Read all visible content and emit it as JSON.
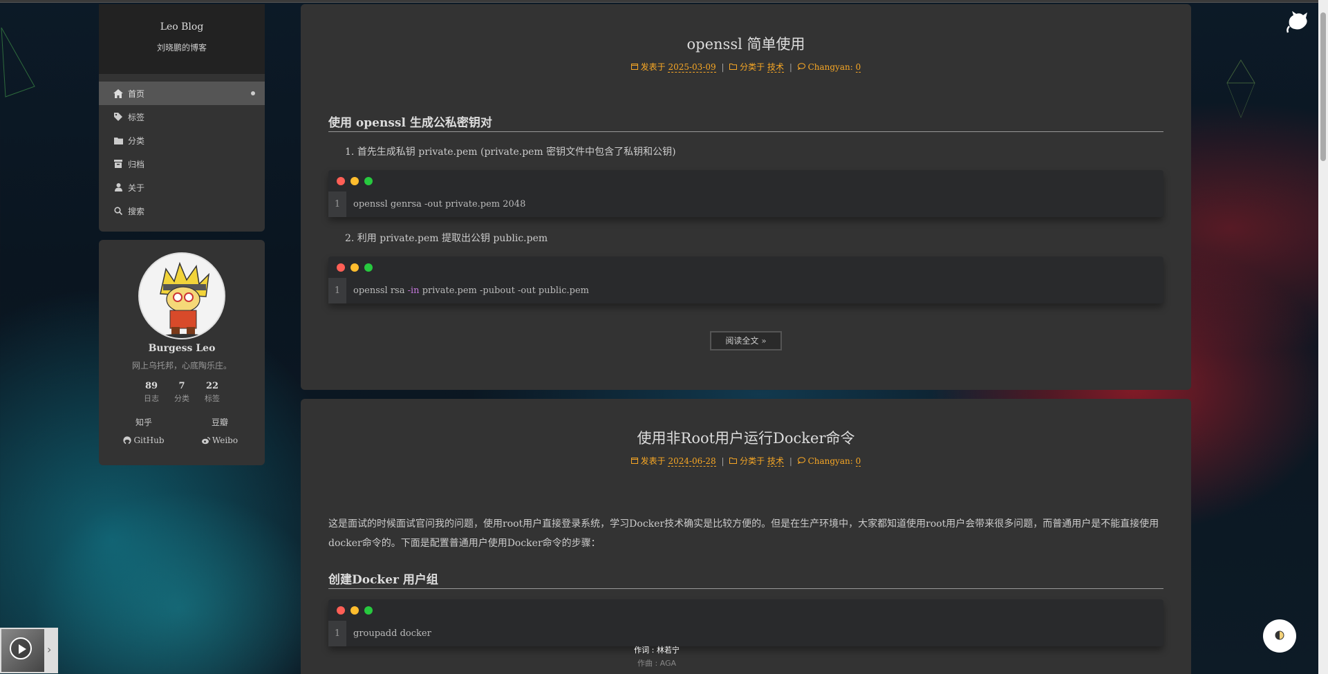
{
  "site": {
    "title": "Leo Blog",
    "subtitle": "刘晓鹏的博客"
  },
  "menu": {
    "items": [
      {
        "label": "首页",
        "icon": "home-icon"
      },
      {
        "label": "标签",
        "icon": "tag-icon"
      },
      {
        "label": "分类",
        "icon": "folder-icon"
      },
      {
        "label": "归档",
        "icon": "archive-icon"
      },
      {
        "label": "关于",
        "icon": "user-icon"
      },
      {
        "label": "搜索",
        "icon": "search-icon"
      }
    ]
  },
  "profile": {
    "name": "Burgess Leo",
    "description": "网上乌托邦，心底陶乐庄。",
    "stats": [
      {
        "num": "89",
        "label": "日志"
      },
      {
        "num": "7",
        "label": "分类"
      },
      {
        "num": "22",
        "label": "标签"
      }
    ],
    "links": [
      {
        "label": "知乎"
      },
      {
        "label": "豆瓣"
      },
      {
        "label": "GitHub",
        "icon": "github-icon"
      },
      {
        "label": "Weibo",
        "icon": "weibo-icon"
      }
    ]
  },
  "posts": [
    {
      "title": "openssl 简单使用",
      "meta": {
        "posted_prefix": "发表于",
        "date": "2025-03-09",
        "category_prefix": "分类于",
        "category": "技术",
        "comments_label": "Changyan:",
        "comments": "0"
      },
      "heading": "使用 openssl 生成公私密钥对",
      "steps": [
        "1. 首先生成私钥 private.pem (private.pem 密钥文件中包含了私钥和公钥)",
        "2. 利用 private.pem 提取出公钥 public.pem"
      ],
      "code1": {
        "line_no": "1",
        "pre": "openssl genrsa -out private.pem 2048"
      },
      "code2": {
        "line_no": "1",
        "pre": "openssl rsa ",
        "kw": "-in",
        "post": " private.pem -pubout -out public.pem"
      },
      "read_more": "阅读全文 »"
    },
    {
      "title": "使用非Root用户运行Docker命令",
      "meta": {
        "posted_prefix": "发表于",
        "date": "2024-06-28",
        "category_prefix": "分类于",
        "category": "技术",
        "comments_label": "Changyan:",
        "comments": "0"
      },
      "intro": "这是面试的时候面试官问我的问题，使用root用户直接登录系统，学习Docker技术确实是比较方便的。但是在生产环境中，大家都知道使用root用户会带来很多问题，而普通用户是不能直接使用docker命令的。下面是配置普通用户使用Docker命令的步骤：",
      "heading": "创建Docker 用户组",
      "code1": {
        "line_no": "1",
        "pre": "groupadd docker"
      }
    }
  ],
  "player": {
    "lyric_line1": "作词 : 林若宁",
    "lyric_line2": "作曲 : AGA"
  },
  "colors": {
    "accent": "#f9a825",
    "dot_red": "#ff5f56",
    "dot_yellow": "#ffbd2e",
    "dot_green": "#27c93f"
  }
}
